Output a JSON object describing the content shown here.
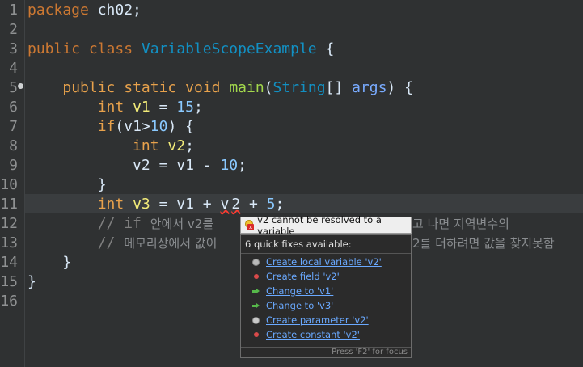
{
  "editor": {
    "line_numbers": [
      "1",
      "2",
      "3",
      "4",
      "5",
      "6",
      "7",
      "8",
      "9",
      "10",
      "11",
      "12",
      "13",
      "14",
      "15",
      "16"
    ],
    "code": {
      "l1_kw": "package",
      "l1_rest": " ch02;",
      "l3_kw1": "public",
      "l3_kw2": "class",
      "l3_cls": "VariableScopeExample",
      "l3_brace": " {",
      "l5_kw1": "public",
      "l5_kw2": "static",
      "l5_kw3": "void",
      "l5_fn": "main",
      "l5_p1": "(",
      "l5_type": "String",
      "l5_arr": "[] ",
      "l5_param": "args",
      "l5_end": ") {",
      "l6_type": "int",
      "l6_var": "v1",
      "l6_op": " = ",
      "l6_num": "15",
      "l6_end": ";",
      "l7_kw": "if",
      "l7_open": "(",
      "l7_var": "v1",
      "l7_op": ">",
      "l7_num": "10",
      "l7_end": ") {",
      "l8_type": "int",
      "l8_var": "v2",
      "l8_end": ";",
      "l9_var": "v2",
      "l9_op": " = ",
      "l9_var2": "v1",
      "l9_op2": " - ",
      "l9_num": "10",
      "l9_end": ";",
      "l10": "}",
      "l11_type": "int",
      "l11_var": "v3",
      "l11_op": " = ",
      "l11_var2": "v1",
      "l11_op2": " + ",
      "l11_err_a": "v",
      "l11_err_b": "2",
      "l11_op3": " + ",
      "l11_num": "5",
      "l11_end": ";",
      "l12_c": "// if ",
      "l12_k1": "안에서 v2를",
      "l12_k2": "고 나면 지역변수의",
      "l13_c": "// ",
      "l13_k1": "메모리상에서 값이",
      "l13_k2": "2를 더하려면 값을 찾지못함",
      "l14": "}",
      "l15": "}"
    }
  },
  "popup": {
    "title": "v2 cannot be resolved to a variable",
    "header": "6 quick fixes available:",
    "fixes": [
      {
        "label": "Create local variable 'v2'",
        "icon": "local-variable-icon"
      },
      {
        "label": "Create field 'v2'",
        "icon": "field-icon"
      },
      {
        "label": "Change to 'v1'",
        "icon": "change-arrow-icon"
      },
      {
        "label": "Change to 'v3'",
        "icon": "change-arrow-icon"
      },
      {
        "label": "Create parameter 'v2'",
        "icon": "parameter-icon"
      },
      {
        "label": "Create constant 'v2'",
        "icon": "constant-icon"
      }
    ],
    "footer": "Press 'F2' for focus"
  },
  "colors": {
    "background": "#2f3132",
    "keyword": "#cc7832",
    "class_name": "#1290c3",
    "method": "#a3d84c",
    "variable": "#f3ec79",
    "link": "#6aa9ff"
  }
}
